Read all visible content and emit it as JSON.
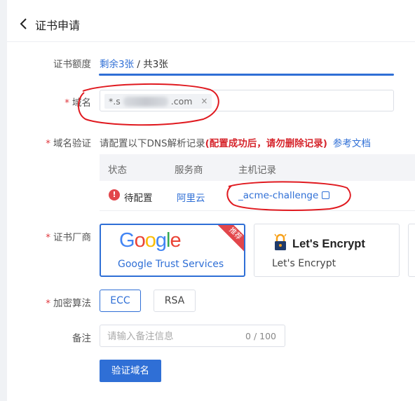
{
  "header": {
    "title": "证书申请"
  },
  "form": {
    "quota": {
      "label": "证书额度",
      "remain": "剩余3张",
      "total": " / 共3张",
      "fill": 1.0
    },
    "domain": {
      "required": "*",
      "label": "域名",
      "tag_prefix": "*.s",
      "tag_suffix": ".com",
      "tag_close": "×"
    },
    "dns": {
      "required": "*",
      "label": "域名验证",
      "hint": "请配置以下DNS解析记录",
      "warn": "(配置成功后，请勿删除记录)",
      "doc_link": "参考文档",
      "columns": [
        "状态",
        "服务商",
        "主机记录"
      ],
      "row": {
        "status_icon": "!",
        "status": "待配置",
        "provider": "阿里云",
        "host": "_acme-challenge"
      }
    },
    "vendor": {
      "required": "*",
      "label": "证书厂商",
      "google": {
        "logo": "Google",
        "name": "Google Trust Services",
        "badge": "推荐"
      },
      "letsencrypt": {
        "logo": "Let's Encrypt",
        "name": "Let's Encrypt"
      }
    },
    "algorithm": {
      "required": "*",
      "label": "加密算法",
      "options": [
        "ECC",
        "RSA"
      ],
      "selected": "ECC"
    },
    "remark": {
      "label": "备注",
      "placeholder": "请输入备注信息",
      "counter": "0 / 100"
    },
    "submit": "验证域名"
  },
  "colors": {
    "accent": "#2f6fd6",
    "danger": "#e2464b",
    "annotation": "#e0191f"
  },
  "icons": {
    "back": "chevron-left-icon",
    "status": "exclamation-circle-icon",
    "copy": "copy-icon",
    "tag_close": "close-icon",
    "letsencrypt": "padlock-icon"
  }
}
